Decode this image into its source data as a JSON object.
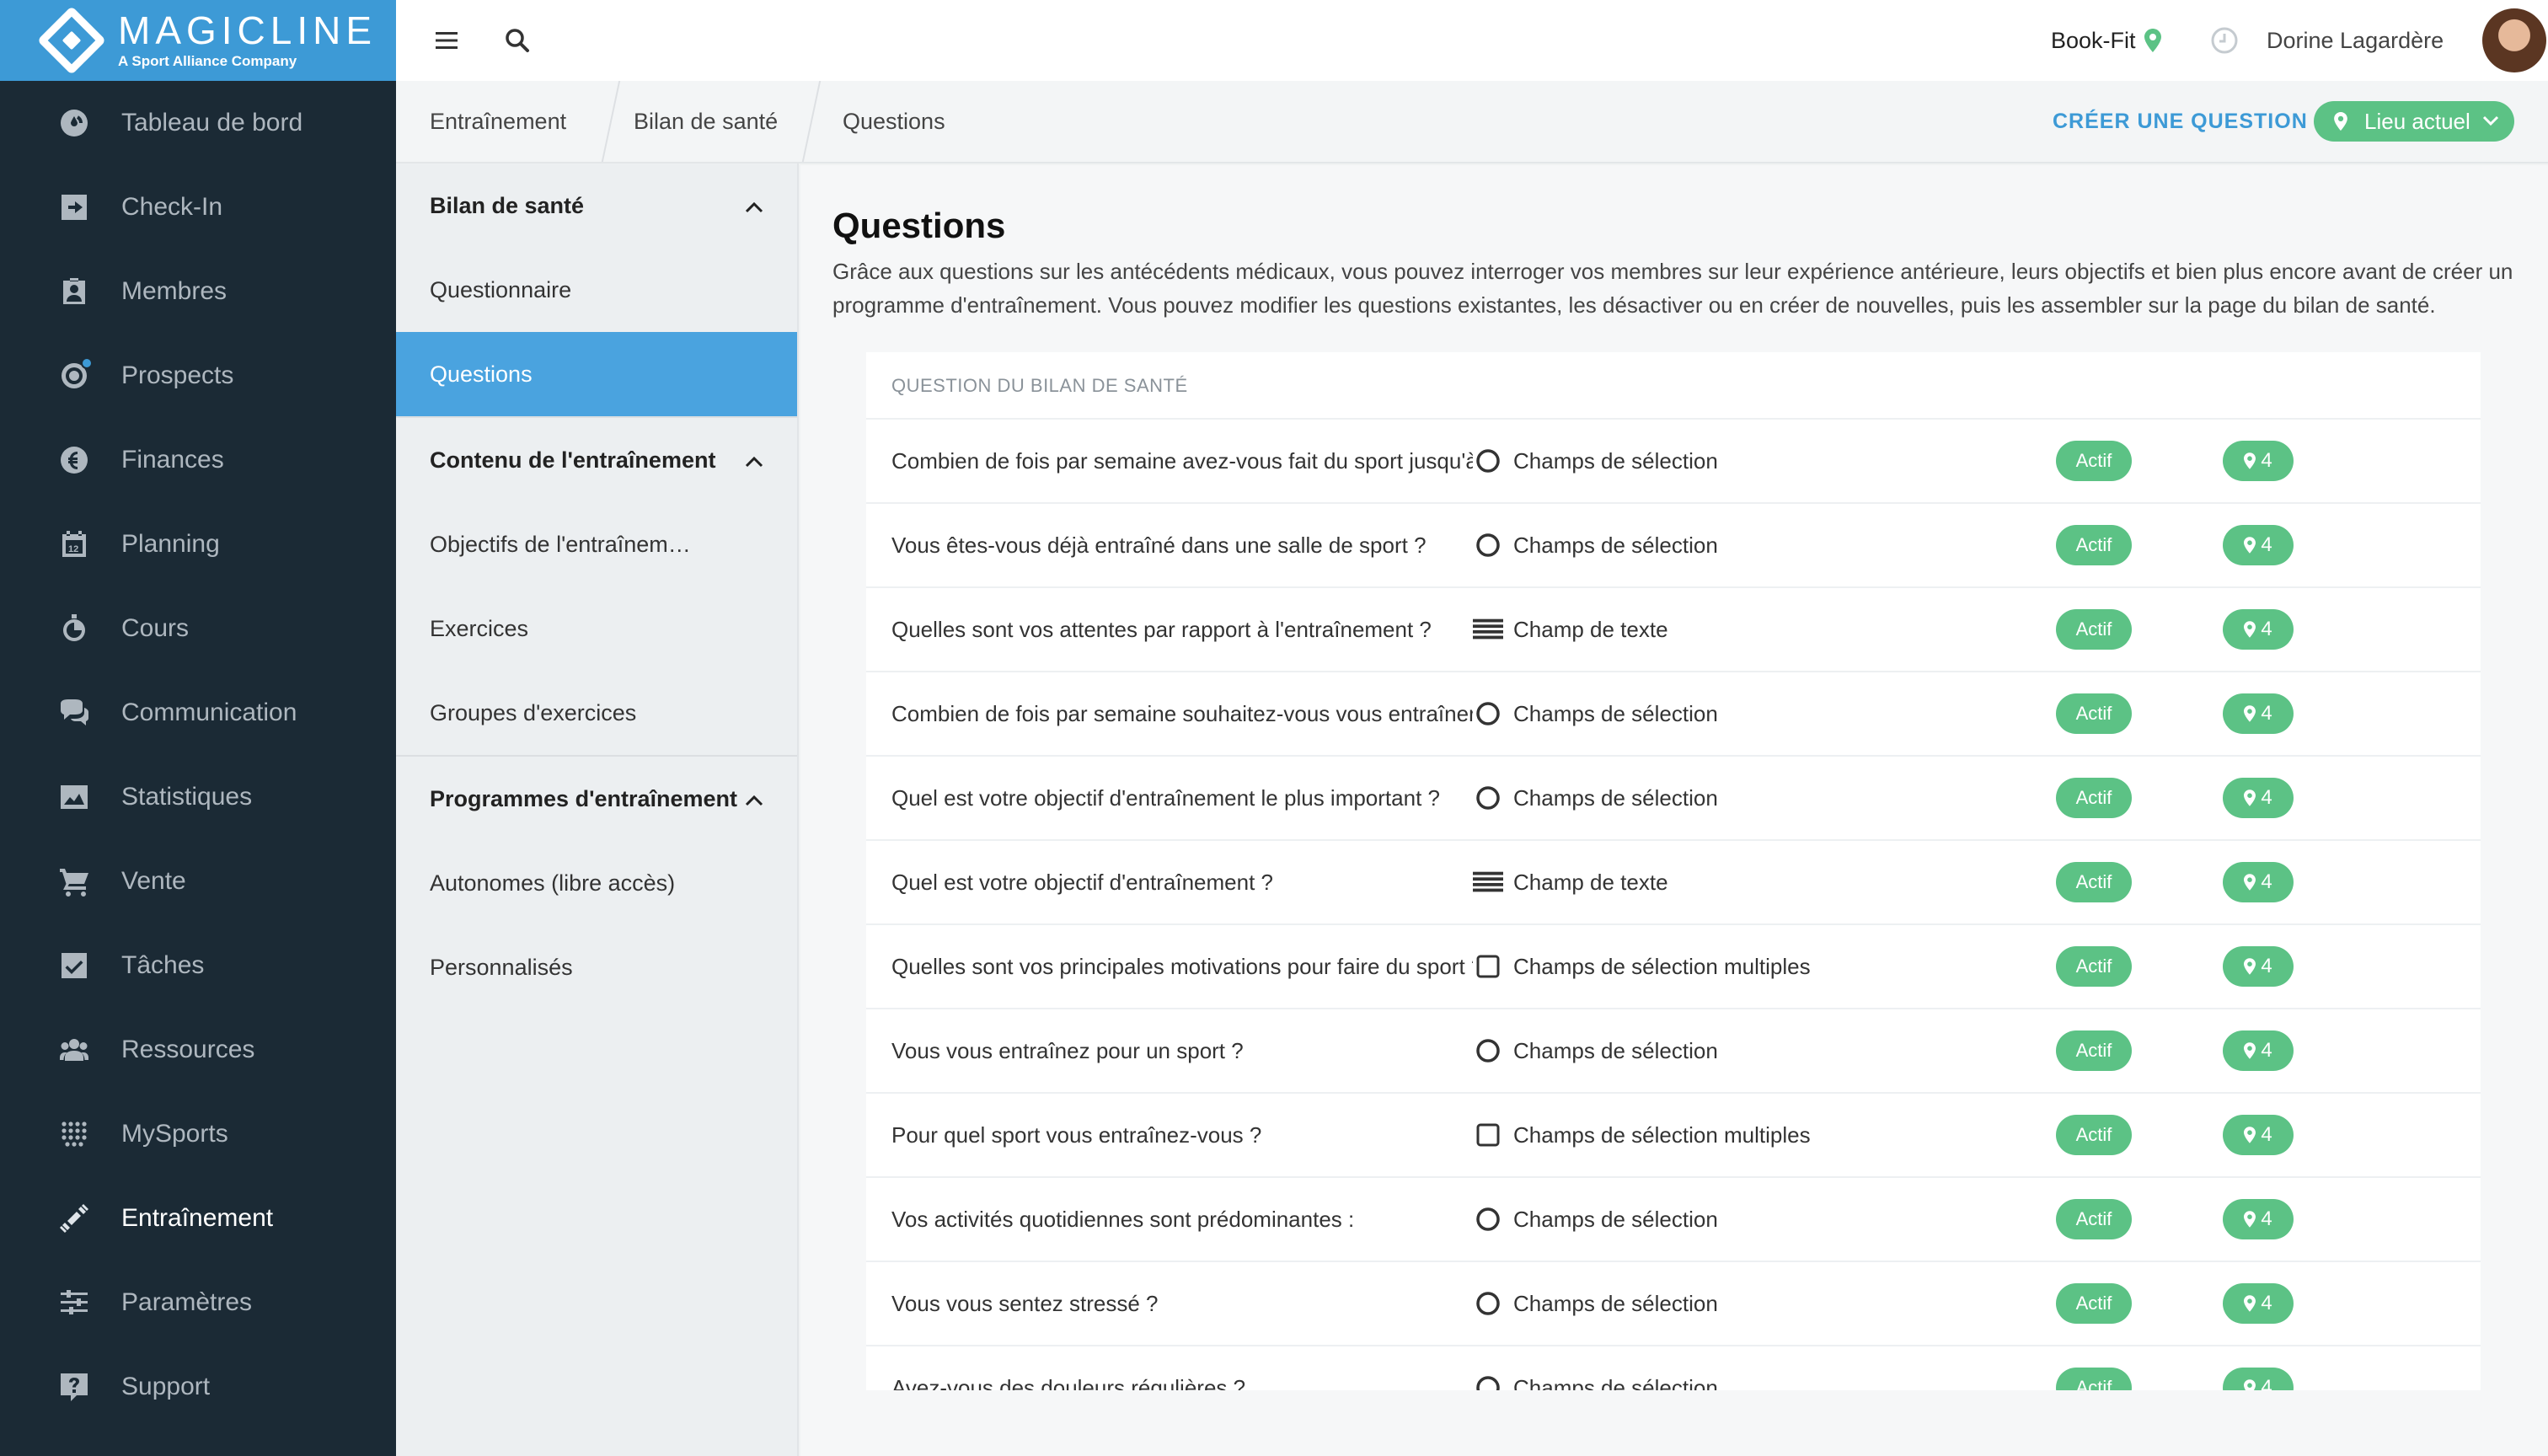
{
  "brand": {
    "name": "MAGICLINE",
    "tagline": "A Sport Alliance Company"
  },
  "sidebar": {
    "items": [
      {
        "label": "Tableau de bord",
        "icon": "dashboard-icon"
      },
      {
        "label": "Check-In",
        "icon": "check-in-icon"
      },
      {
        "label": "Membres",
        "icon": "members-icon"
      },
      {
        "label": "Prospects",
        "icon": "prospects-icon"
      },
      {
        "label": "Finances",
        "icon": "euro-icon"
      },
      {
        "label": "Planning",
        "icon": "calendar-icon"
      },
      {
        "label": "Cours",
        "icon": "stopwatch-icon"
      },
      {
        "label": "Communication",
        "icon": "chat-icon"
      },
      {
        "label": "Statistiques",
        "icon": "chart-icon"
      },
      {
        "label": "Vente",
        "icon": "cart-icon"
      },
      {
        "label": "Tâches",
        "icon": "checkbox-icon"
      },
      {
        "label": "Ressources",
        "icon": "users-icon"
      },
      {
        "label": "MySports",
        "icon": "dots-grid-icon"
      },
      {
        "label": "Entraînement",
        "icon": "dumbbell-icon",
        "active": true
      },
      {
        "label": "Paramètres",
        "icon": "sliders-icon"
      },
      {
        "label": "Support",
        "icon": "help-icon"
      }
    ]
  },
  "topbar": {
    "studio": "Book-Fit",
    "user": "Dorine Lagardère"
  },
  "breadcrumb": [
    "Entraînement",
    "Bilan de santé",
    "Questions"
  ],
  "actions": {
    "create": "CRÉER UNE QUESTION",
    "location": "Lieu actuel"
  },
  "subnav": {
    "groups": [
      {
        "label": "Bilan de santé",
        "items": [
          "Questionnaire",
          "Questions"
        ]
      },
      {
        "label": "Contenu de l'entraînement",
        "items": [
          "Objectifs de l'entraînem…",
          "Exercices",
          "Groupes d'exercices"
        ]
      },
      {
        "label": "Programmes d'entraînement",
        "items": [
          "Autonomes (libre accès)",
          "Personnalisés"
        ]
      }
    ],
    "active": "Questions"
  },
  "main": {
    "title": "Questions",
    "description": "Grâce aux questions sur les antécédents médicaux, vous pouvez interroger vos membres sur leur expérience antérieure, leurs objectifs et bien plus encore avant de créer un programme d'entraînement. Vous pouvez modifier les questions existantes, les désactiver ou en créer de nouvelles, puis les assembler sur la page du bilan de santé.",
    "table_header": "QUESTION DU BILAN DE SANTÉ",
    "rows": [
      {
        "question": "Combien de fois par semaine avez-vous fait du sport jusqu'à présent ?",
        "type": "Champs de sélection",
        "type_icon": "radio-icon",
        "status": "Actif",
        "locations": "4"
      },
      {
        "question": "Vous êtes-vous déjà entraîné dans une salle de sport ?",
        "type": "Champs de sélection",
        "type_icon": "radio-icon",
        "status": "Actif",
        "locations": "4"
      },
      {
        "question": "Quelles sont vos attentes par rapport à l'entraînement ?",
        "type": "Champ de texte",
        "type_icon": "text-lines-icon",
        "status": "Actif",
        "locations": "4"
      },
      {
        "question": "Combien de fois par semaine souhaitez-vous vous entraîner ?",
        "type": "Champs de sélection",
        "type_icon": "radio-icon",
        "status": "Actif",
        "locations": "4"
      },
      {
        "question": "Quel est votre objectif d'entraînement le plus important ?",
        "type": "Champs de sélection",
        "type_icon": "radio-icon",
        "status": "Actif",
        "locations": "4"
      },
      {
        "question": "Quel est votre objectif d'entraînement ?",
        "type": "Champ de texte",
        "type_icon": "text-lines-icon",
        "status": "Actif",
        "locations": "4"
      },
      {
        "question": "Quelles sont vos principales motivations pour faire du sport ?",
        "type": "Champs de sélection multiples",
        "type_icon": "checkbox-icon",
        "status": "Actif",
        "locations": "4"
      },
      {
        "question": "Vous vous entraînez pour un sport ?",
        "type": "Champs de sélection",
        "type_icon": "radio-icon",
        "status": "Actif",
        "locations": "4"
      },
      {
        "question": "Pour quel sport vous entraînez-vous ?",
        "type": "Champs de sélection multiples",
        "type_icon": "checkbox-icon",
        "status": "Actif",
        "locations": "4"
      },
      {
        "question": "Vos activités quotidiennes sont prédominantes :",
        "type": "Champs de sélection",
        "type_icon": "radio-icon",
        "status": "Actif",
        "locations": "4"
      },
      {
        "question": "Vous vous sentez stressé ?",
        "type": "Champs de sélection",
        "type_icon": "radio-icon",
        "status": "Actif",
        "locations": "4"
      },
      {
        "question": "Avez-vous des douleurs régulières ?",
        "type": "Champs de sélection",
        "type_icon": "radio-icon",
        "status": "Actif",
        "locations": "4"
      }
    ]
  },
  "colors": {
    "sidebar": "#1b2a35",
    "brand": "#3d9ad6",
    "active_nav": "#4aa3df",
    "success": "#5cc285"
  }
}
